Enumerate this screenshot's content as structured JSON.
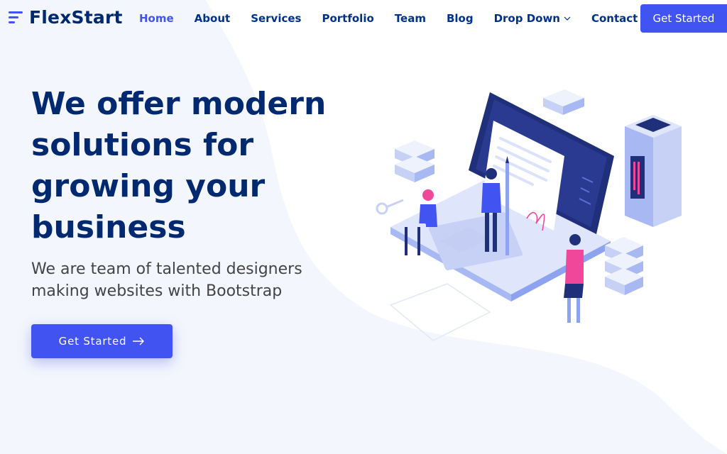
{
  "brand": {
    "name": "FlexStart"
  },
  "nav": {
    "items": [
      {
        "label": "Home",
        "active": true
      },
      {
        "label": "About"
      },
      {
        "label": "Services"
      },
      {
        "label": "Portfolio"
      },
      {
        "label": "Team"
      },
      {
        "label": "Blog"
      },
      {
        "label": "Drop Down",
        "has_dropdown": true
      },
      {
        "label": "Contact"
      }
    ],
    "cta_label": "Get Started"
  },
  "hero": {
    "title": "We offer modern solutions for growing your business",
    "subtitle": "We are team of talented designers making websites with Bootstrap",
    "cta_label": "Get Started",
    "illustration": "isometric-laptop-team-illustration"
  },
  "colors": {
    "accent": "#4154f1",
    "heading": "#012970",
    "nav_text": "#013289",
    "body_text": "#444444",
    "background": "#f4f6fd",
    "illustration_pink": "#f1479a"
  },
  "icons": [
    "hamburger-logo-icon",
    "chevron-down-icon",
    "arrow-right-icon"
  ]
}
